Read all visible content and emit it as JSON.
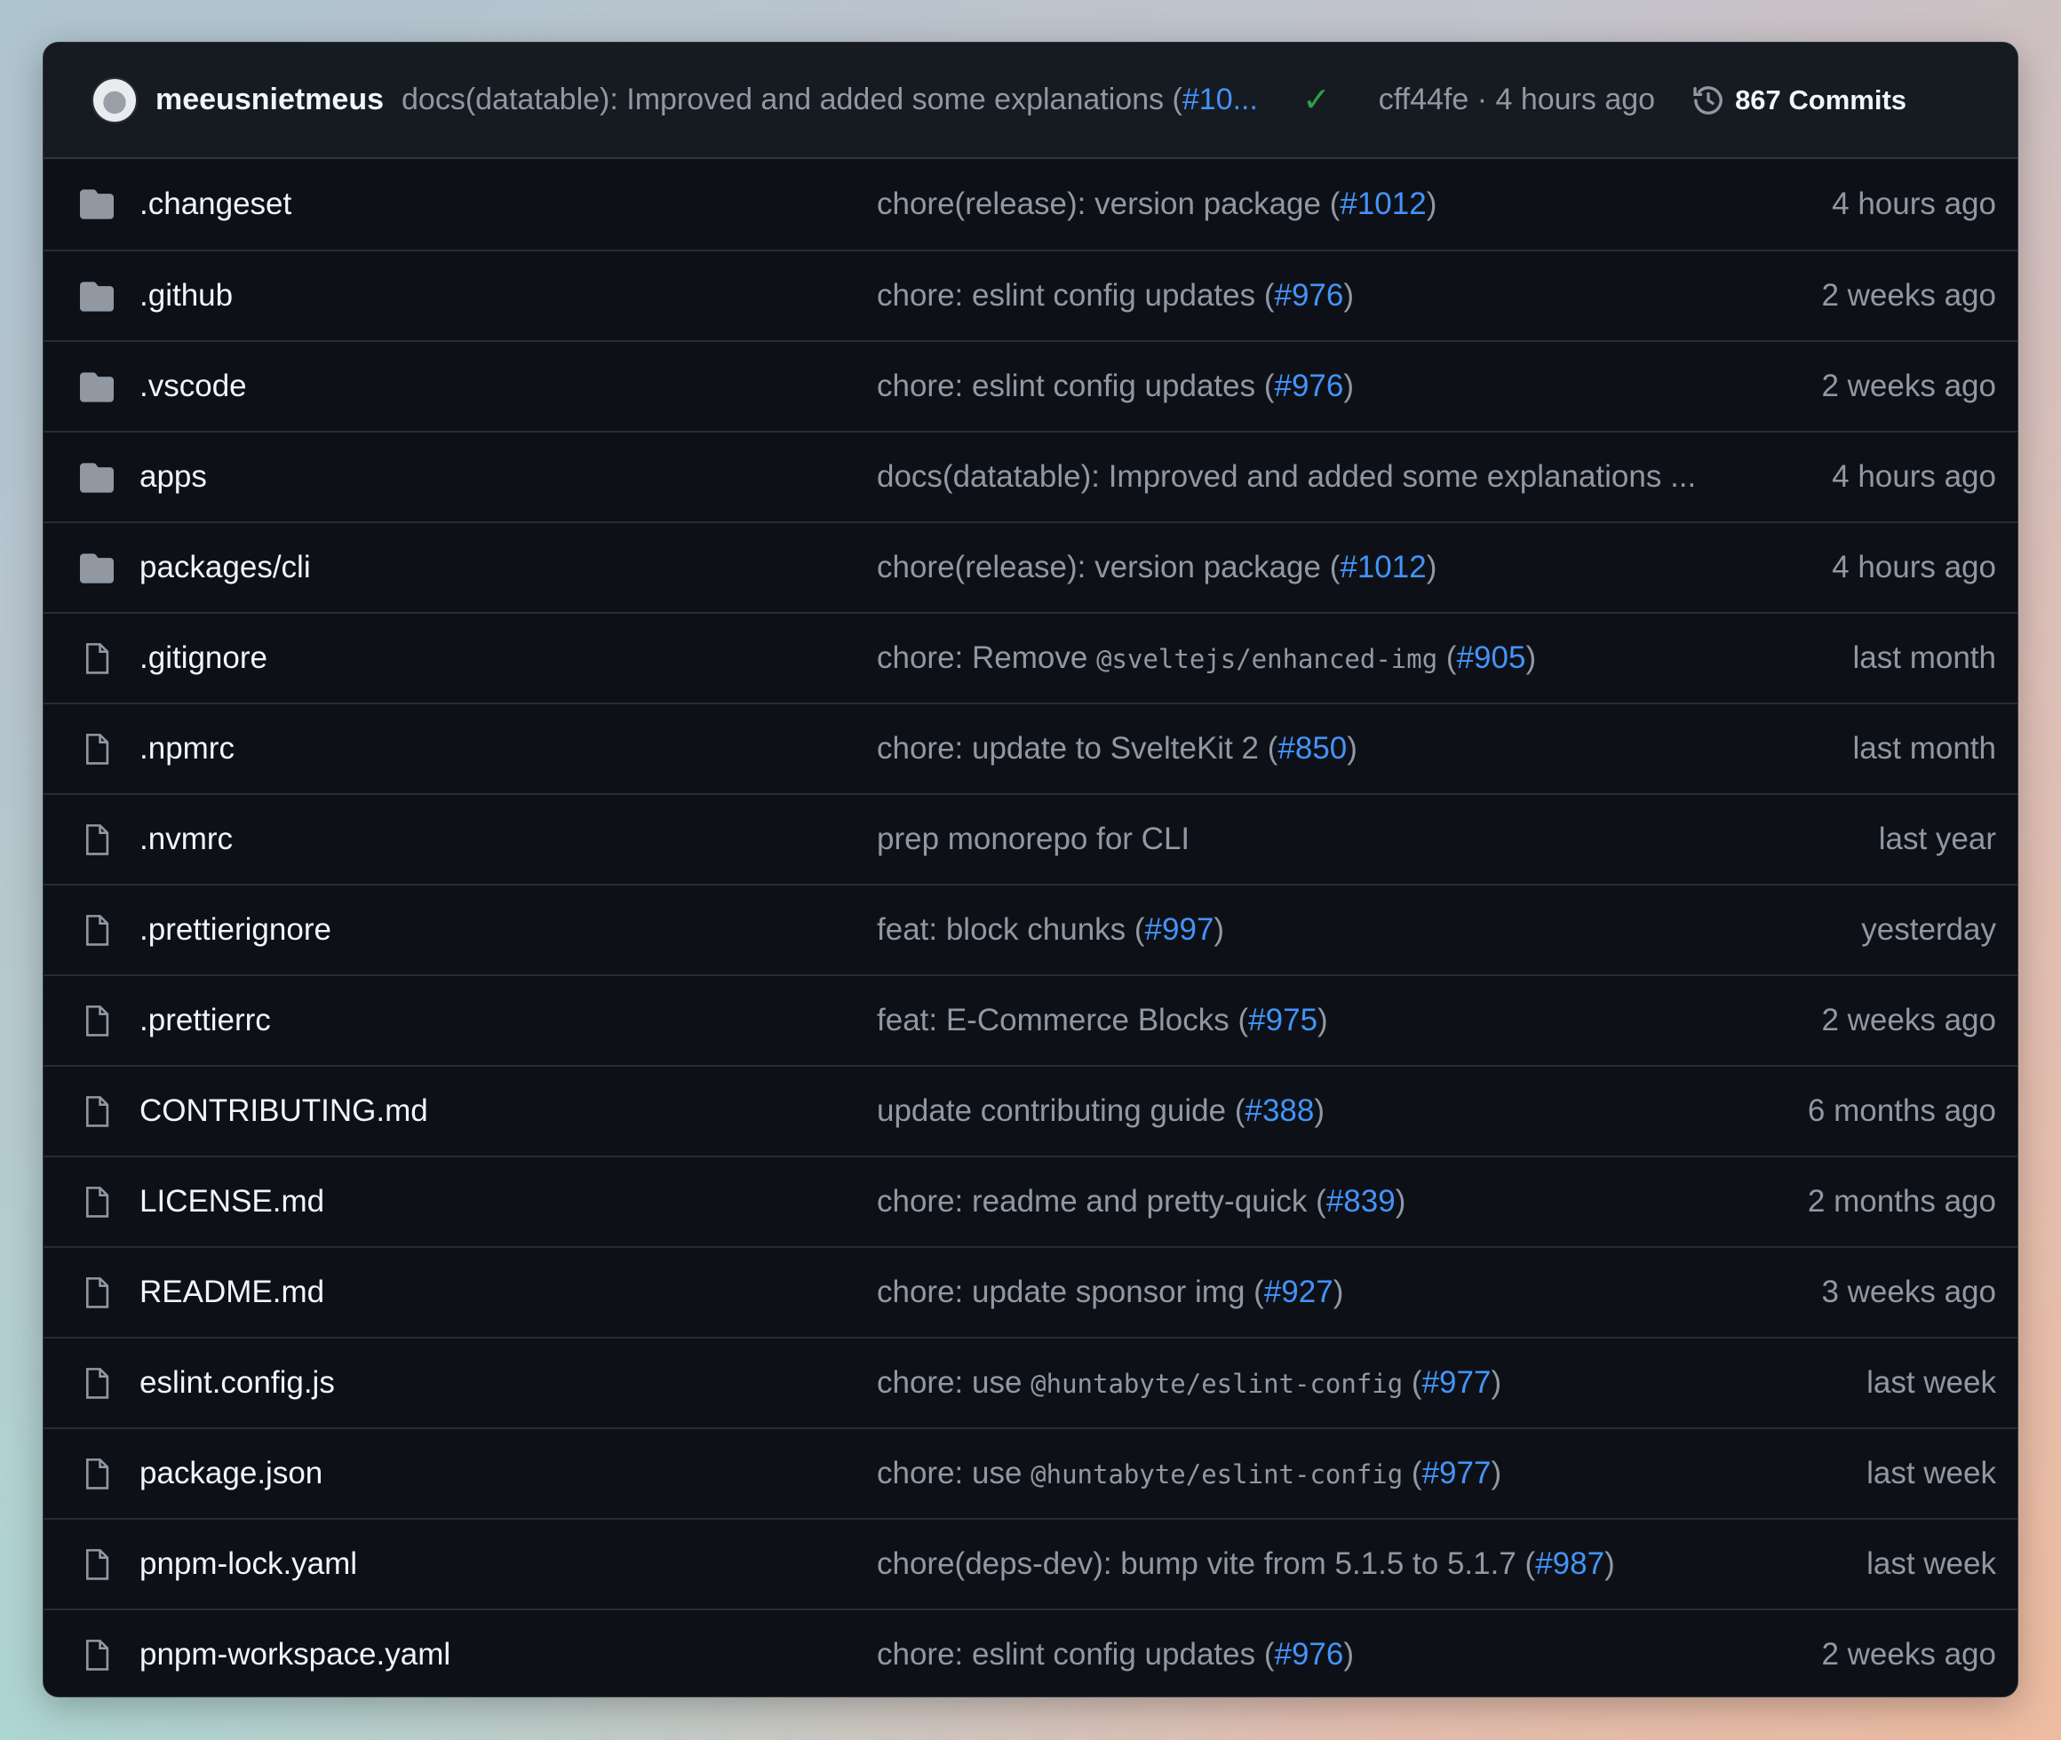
{
  "header": {
    "author": "meeusnietmeus",
    "message": "docs(datatable): Improved and added some explanations (",
    "message_link": "#10...",
    "status": "success",
    "sha": "cff44fe",
    "time": "· 4 hours ago",
    "commits": "867 Commits"
  },
  "colors": {
    "link": "#4493f8",
    "text": "#f0f6fc",
    "muted": "#9198a1",
    "success": "#2ea043"
  },
  "files": [
    {
      "name": ".changeset",
      "type": "folder",
      "text": "chore(release): version package",
      "code": "",
      "pr": "#1012",
      "date": "4 hours ago"
    },
    {
      "name": ".github",
      "type": "folder",
      "text": "chore: eslint config updates",
      "code": "",
      "pr": "#976",
      "date": "2 weeks ago"
    },
    {
      "name": ".vscode",
      "type": "folder",
      "text": "chore: eslint config updates",
      "code": "",
      "pr": "#976",
      "date": "2 weeks ago"
    },
    {
      "name": "apps",
      "type": "folder",
      "text": "docs(datatable): Improved and added some explanations ...",
      "code": "",
      "pr": "",
      "date": "4 hours ago"
    },
    {
      "name": "packages/cli",
      "type": "folder",
      "text": "chore(release): version package",
      "code": "",
      "pr": "#1012",
      "date": "4 hours ago"
    },
    {
      "name": ".gitignore",
      "type": "file",
      "text": "chore: Remove",
      "code": "@sveltejs/enhanced-img",
      "pr": "#905",
      "date": "last month"
    },
    {
      "name": ".npmrc",
      "type": "file",
      "text": "chore: update to SvelteKit 2",
      "code": "",
      "pr": "#850",
      "date": "last month"
    },
    {
      "name": ".nvmrc",
      "type": "file",
      "text": "prep monorepo for CLI",
      "code": "",
      "pr": "",
      "date": "last year"
    },
    {
      "name": ".prettierignore",
      "type": "file",
      "text": "feat: block chunks",
      "code": "",
      "pr": "#997",
      "date": "yesterday"
    },
    {
      "name": ".prettierrc",
      "type": "file",
      "text": "feat: E-Commerce Blocks",
      "code": "",
      "pr": "#975",
      "date": "2 weeks ago"
    },
    {
      "name": "CONTRIBUTING.md",
      "type": "file",
      "text": "update contributing guide",
      "code": "",
      "pr": "#388",
      "date": "6 months ago"
    },
    {
      "name": "LICENSE.md",
      "type": "file",
      "text": "chore: readme and pretty-quick",
      "code": "",
      "pr": "#839",
      "date": "2 months ago"
    },
    {
      "name": "README.md",
      "type": "file",
      "text": "chore: update sponsor img",
      "code": "",
      "pr": "#927",
      "date": "3 weeks ago"
    },
    {
      "name": "eslint.config.js",
      "type": "file",
      "text": "chore: use",
      "code": "@huntabyte/eslint-config",
      "pr": "#977",
      "date": "last week"
    },
    {
      "name": "package.json",
      "type": "file",
      "text": "chore: use",
      "code": "@huntabyte/eslint-config",
      "pr": "#977",
      "date": "last week"
    },
    {
      "name": "pnpm-lock.yaml",
      "type": "file",
      "text": "chore(deps-dev): bump vite from 5.1.5 to 5.1.7",
      "code": "",
      "pr": "#987",
      "date": "last week"
    },
    {
      "name": "pnpm-workspace.yaml",
      "type": "file",
      "text": "chore: eslint config updates",
      "code": "",
      "pr": "#976",
      "date": "2 weeks ago"
    }
  ]
}
